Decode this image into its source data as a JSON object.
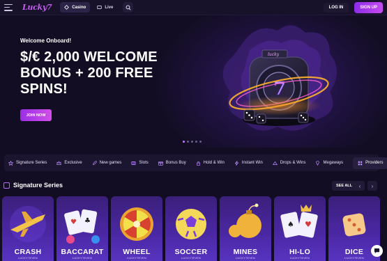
{
  "header": {
    "logo": "Lucky7",
    "tabs": [
      {
        "label": "Casino"
      },
      {
        "label": "Live"
      }
    ],
    "login_label": "LOG IN",
    "signup_label": "SIGN UP"
  },
  "hero": {
    "kicker": "Welcome Onboard!",
    "title": "$/€ 2,000 WELCOME BONUS + 200 FREE SPINS!",
    "cta_label": "JOIN NOW",
    "slides": 5,
    "active_slide": 1
  },
  "categories": {
    "items": [
      {
        "label": "Signature Series",
        "icon": "star-icon"
      },
      {
        "label": "Exclusive",
        "icon": "crown-icon"
      },
      {
        "label": "New games",
        "icon": "rocket-icon"
      },
      {
        "label": "Slots",
        "icon": "slot-icon"
      },
      {
        "label": "Bonus Buy",
        "icon": "gift-icon"
      },
      {
        "label": "Hold & Win",
        "icon": "lock-icon"
      },
      {
        "label": "Instant Win",
        "icon": "lightning-icon"
      },
      {
        "label": "Drops & Wins",
        "icon": "drop-icon"
      },
      {
        "label": "Megaways",
        "icon": "diamond-icon"
      }
    ],
    "providers_label": "Providers"
  },
  "section": {
    "title": "Signature Series",
    "see_all_label": "SEE ALL",
    "prev_arrow": "‹",
    "next_arrow": "›"
  },
  "games": [
    {
      "name": "CRASH",
      "maker": "LUCKY7EVEN"
    },
    {
      "name": "BACCARAT",
      "maker": "LUCKY7EVEN"
    },
    {
      "name": "WHEEL",
      "maker": "LUCKY7EVEN"
    },
    {
      "name": "SOCCER",
      "maker": "LUCKY7EVEN"
    },
    {
      "name": "MINES",
      "maker": "LUCKY7EVEN"
    },
    {
      "name": "HI-LO",
      "maker": "LUCKY7EVEN"
    },
    {
      "name": "DICE",
      "maker": "LUCKY7EVEN"
    }
  ],
  "colors": {
    "background": "#120d22",
    "accent": "#b34bf0",
    "card": "#4a28a4"
  }
}
